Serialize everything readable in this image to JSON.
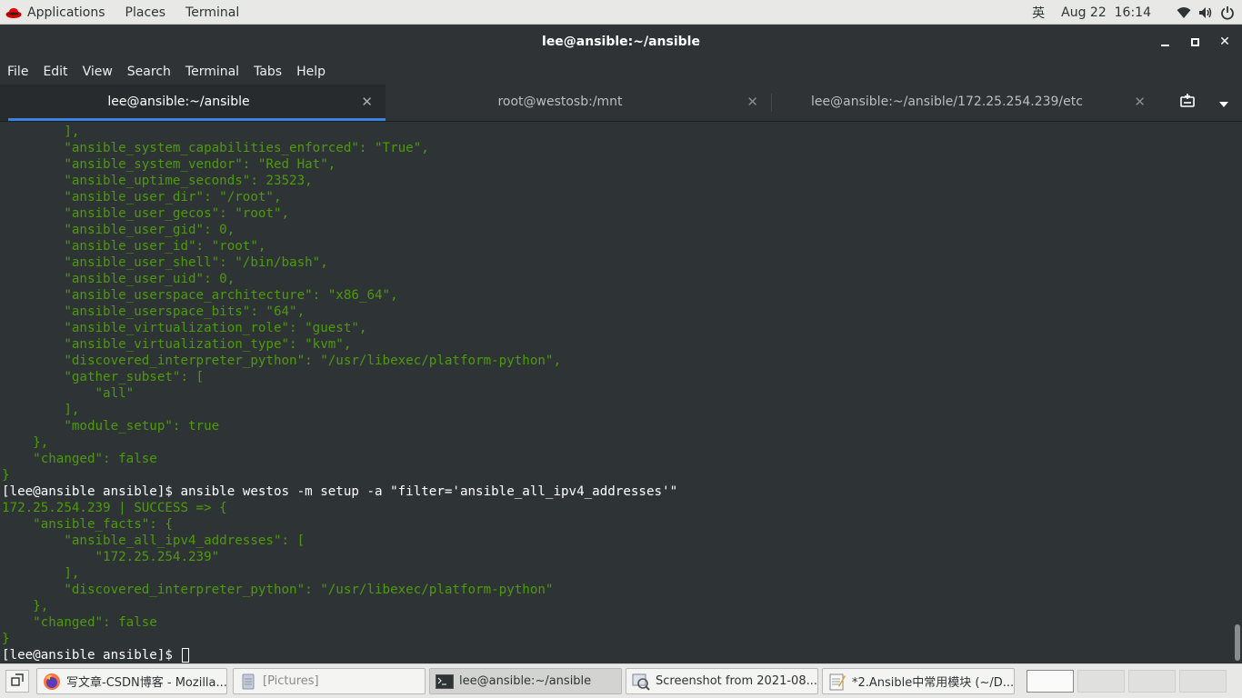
{
  "topbar": {
    "applications": "Applications",
    "places": "Places",
    "terminal": "Terminal",
    "ime": "英",
    "date": "Aug 22",
    "time": "16:14"
  },
  "window": {
    "title": "lee@ansible:~/ansible"
  },
  "menu": {
    "file": "File",
    "edit": "Edit",
    "view": "View",
    "search": "Search",
    "terminal": "Terminal",
    "tabs": "Tabs",
    "help": "Help"
  },
  "tabs": [
    {
      "label": "lee@ansible:~/ansible"
    },
    {
      "label": "root@westosb:/mnt"
    },
    {
      "label": "lee@ansible:~/ansible/172.25.254.239/etc"
    }
  ],
  "terminal": {
    "lines": [
      "        ],",
      "        \"ansible_system_capabilities_enforced\": \"True\",",
      "        \"ansible_system_vendor\": \"Red Hat\",",
      "        \"ansible_uptime_seconds\": 23523,",
      "        \"ansible_user_dir\": \"/root\",",
      "        \"ansible_user_gecos\": \"root\",",
      "        \"ansible_user_gid\": 0,",
      "        \"ansible_user_id\": \"root\",",
      "        \"ansible_user_shell\": \"/bin/bash\",",
      "        \"ansible_user_uid\": 0,",
      "        \"ansible_userspace_architecture\": \"x86_64\",",
      "        \"ansible_userspace_bits\": \"64\",",
      "        \"ansible_virtualization_role\": \"guest\",",
      "        \"ansible_virtualization_type\": \"kvm\",",
      "        \"discovered_interpreter_python\": \"/usr/libexec/platform-python\",",
      "        \"gather_subset\": [",
      "            \"all\"",
      "        ],",
      "        \"module_setup\": true",
      "    },",
      "    \"changed\": false",
      "}",
      "[lee@ansible ansible]$ ansible westos -m setup -a \"filter='ansible_all_ipv4_addresses'\"",
      "172.25.254.239 | SUCCESS => {",
      "    \"ansible_facts\": {",
      "        \"ansible_all_ipv4_addresses\": [",
      "            \"172.25.254.239\"",
      "        ],",
      "        \"discovered_interpreter_python\": \"/usr/libexec/platform-python\"",
      "    },",
      "    \"changed\": false",
      "}",
      "[lee@ansible ansible]$ "
    ]
  },
  "taskbar": {
    "tasks": [
      {
        "label": "写文章-CSDN博客 - Mozilla..."
      },
      {
        "label": "[Pictures]"
      },
      {
        "label": "lee@ansible:~/ansible"
      },
      {
        "label": "Screenshot from 2021-08..."
      },
      {
        "label": "*2.Ansible中常用模块 (~/D..."
      }
    ]
  },
  "icons": {
    "redhat": "redhat-logo-icon",
    "wifi": "wifi-icon",
    "volume": "volume-icon",
    "power": "power-icon",
    "new_terminal": "new-terminal-icon",
    "tab_menu": "chevron-down-icon",
    "show_desktop": "show-desktop-icon",
    "firefox": "firefox-icon",
    "files": "files-icon",
    "terminal": "terminal-icon",
    "image_viewer": "image-viewer-icon",
    "text_editor": "text-editor-icon"
  }
}
